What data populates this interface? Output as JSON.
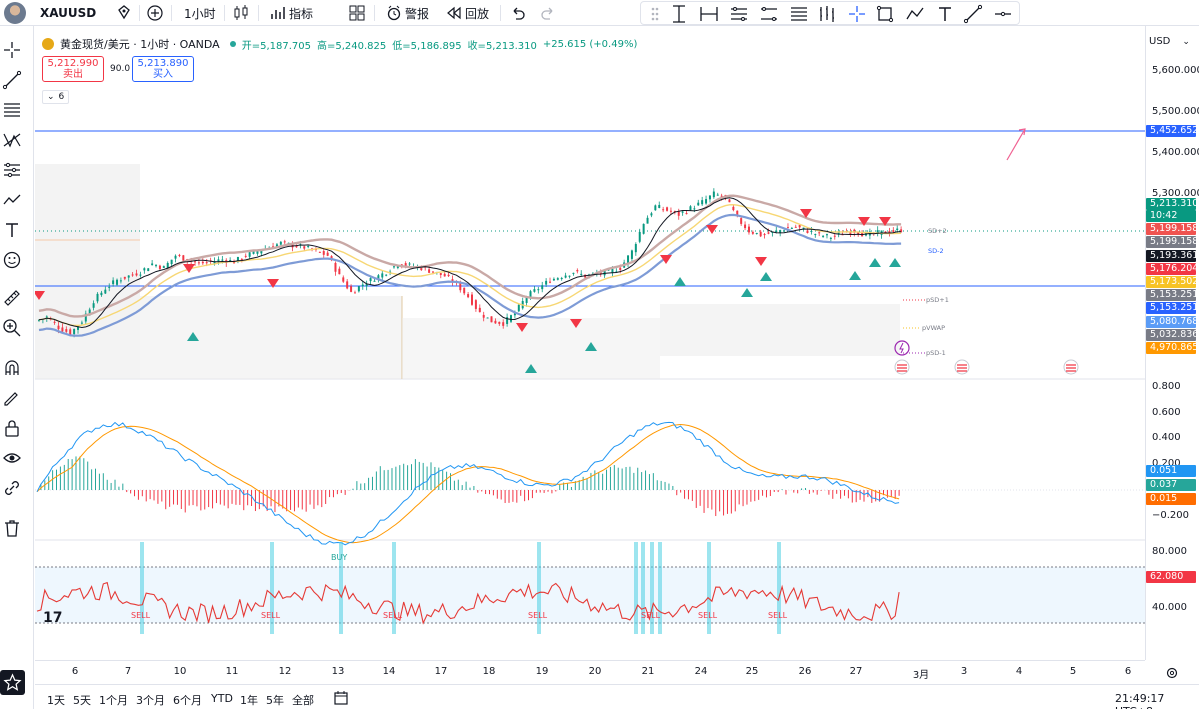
{
  "toolbar": {
    "symbol": "XAUUSD",
    "interval": "1小时",
    "indicators_label": "指标",
    "alert_label": "警报",
    "replay_label": "回放"
  },
  "legend": {
    "title": "黄金现货/美元 · 1小时 · OANDA",
    "open_label": "开=5,187.705",
    "high_label": "高=5,240.825",
    "low_label": "低=5,186.895",
    "close_label": "收=5,213.310",
    "change": "+25.615 (+0.49%)",
    "sell_price": "5,212.990",
    "sell_label": "卖出",
    "spread": "90.0",
    "buy_price": "5,213.890",
    "buy_label": "买入",
    "indicator_count": "6"
  },
  "price_scale": {
    "currency": "USD",
    "ticks": [
      "5,600.000",
      "5,500.000",
      "5,400.000",
      "5,300.000"
    ],
    "tags": [
      {
        "text": "5,452.652",
        "color": "#2962ff"
      },
      {
        "text": "5,213.310",
        "color": "#089981"
      },
      {
        "text": "10:42",
        "color": "#089981"
      },
      {
        "text": "5,199.158",
        "color": "#ef5350"
      },
      {
        "text": "5,199.158",
        "color": "#787b86"
      },
      {
        "text": "5,193.361",
        "color": "#131722"
      },
      {
        "text": "5,176.204",
        "color": "#f23645"
      },
      {
        "text": "5,173.502",
        "color": "#f7c325"
      },
      {
        "text": "5,153.251",
        "color": "#787b86"
      },
      {
        "text": "5,153.251",
        "color": "#2962ff"
      },
      {
        "text": "5,080.768",
        "color": "#5b9cf6"
      },
      {
        "text": "5,032.836",
        "color": "#787b86"
      },
      {
        "text": "4,970.865",
        "color": "#ff9800"
      }
    ],
    "macd_ticks": [
      "0.800",
      "0.600",
      "0.400",
      "0.200",
      "−0.200"
    ],
    "macd_tags": [
      {
        "text": "0.051",
        "color": "#2196f3"
      },
      {
        "text": "0.037",
        "color": "#26a69a"
      },
      {
        "text": "0.015",
        "color": "#ff6d00"
      }
    ],
    "rsi_ticks": [
      "80.000",
      "40.000"
    ],
    "rsi_tag": {
      "text": "62.080",
      "color": "#f23645"
    }
  },
  "vwap_labels": [
    "SD+2",
    "SD-2",
    "pSD+1",
    "pVWAP",
    "pSD-1"
  ],
  "signals": {
    "sell": "SELL",
    "buy": "BUY"
  },
  "time_axis": [
    "6",
    "7",
    "10",
    "11",
    "12",
    "13",
    "14",
    "17",
    "18",
    "19",
    "20",
    "21",
    "24",
    "25",
    "26",
    "27",
    "3月",
    "3",
    "4",
    "5",
    "6"
  ],
  "ranges": [
    "1天",
    "5天",
    "1个月",
    "3个月",
    "6个月",
    "YTD",
    "1年",
    "5年",
    "全部"
  ],
  "clock": "21:49:17 UTC+8",
  "chart_data": {
    "type": "candlestick",
    "symbol": "XAUUSD",
    "interval": "1小时",
    "close_series_approx": [
      5000,
      4975,
      4960,
      4990,
      5040,
      5070,
      5090,
      5100,
      5110,
      5130,
      5120,
      5150,
      5140,
      5130,
      5135,
      5140,
      5135,
      5150,
      5160,
      5170,
      5180,
      5175,
      5170,
      5160,
      5150,
      5100,
      5060,
      5080,
      5095,
      5110,
      5130,
      5125,
      5120,
      5110,
      5100,
      5080,
      5050,
      5010,
      4990,
      4985,
      5010,
      5050,
      5070,
      5090,
      5100,
      5110,
      5100,
      5105,
      5110,
      5120,
      5160,
      5230,
      5270,
      5260,
      5250,
      5265,
      5280,
      5300,
      5290,
      5240,
      5210,
      5200,
      5205,
      5215,
      5220,
      5210,
      5200,
      5195,
      5205,
      5210,
      5200,
      5205,
      5208,
      5213
    ],
    "horizontal_lines": [
      5452.652,
      5193.361
    ],
    "sell_signals": 11,
    "buy_signals": 8,
    "macd_range": [
      -0.25,
      0.85
    ],
    "rsi_range": [
      25,
      85
    ],
    "rsi_last": 62.08
  }
}
